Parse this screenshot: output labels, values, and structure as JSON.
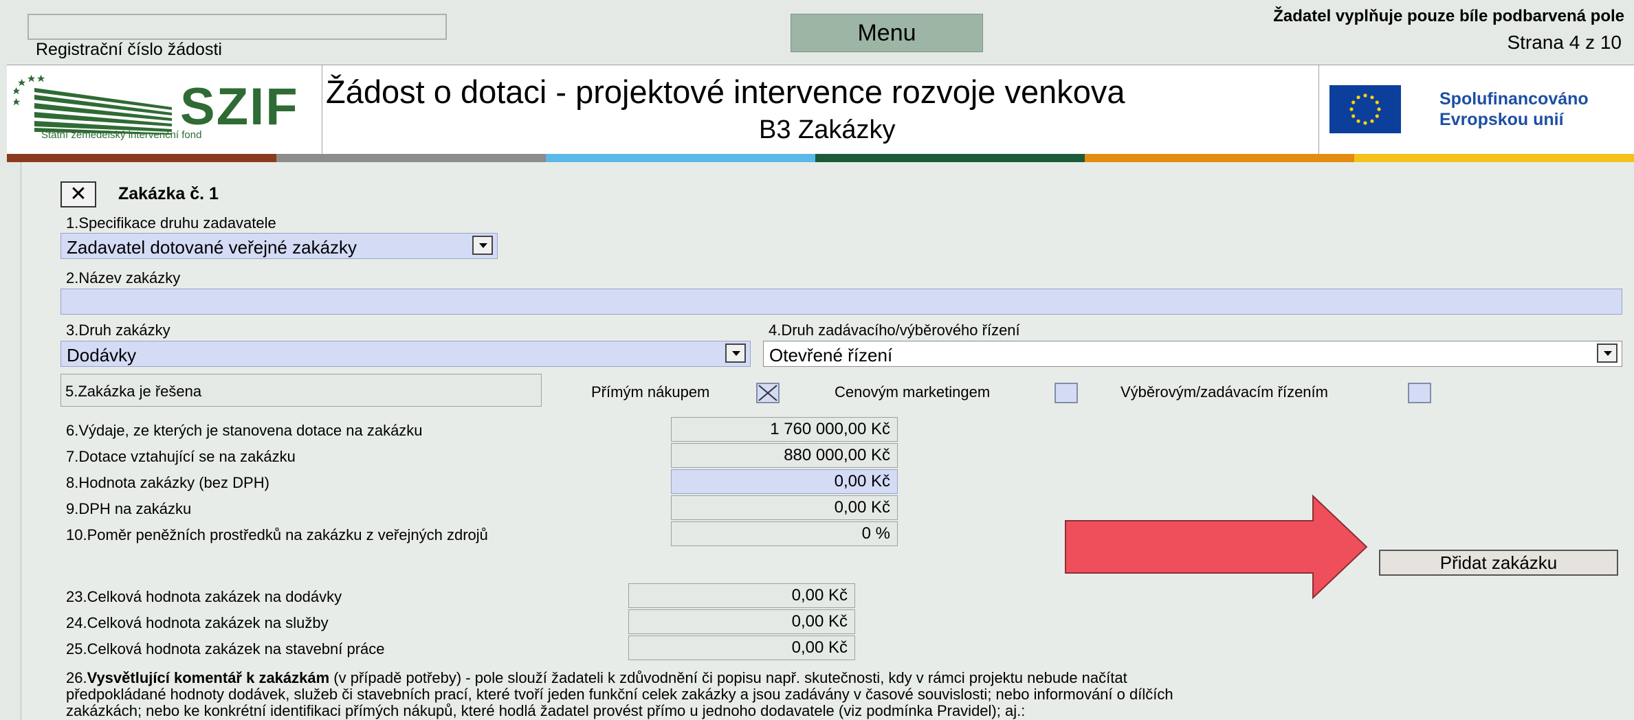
{
  "header": {
    "reg_label": "Registrační číslo žádosti",
    "reg_value": "",
    "menu_label": "Menu",
    "notice": "Žadatel vyplňuje pouze bíle podbarvená pole",
    "page": "Strana 4 z 10"
  },
  "banner": {
    "logo_text": "SZIF",
    "logo_sub": "Státní zemědělský intervenční fond",
    "title": "Žádost o dotaci - projektové intervence rozvoje venkova",
    "subtitle": "B3 Zakázky",
    "eu_line1": "Spolufinancováno",
    "eu_line2": "Evropskou unií"
  },
  "colors": {
    "field_blue": "#d4dbf5",
    "background": "#e4e9e6",
    "arrow": "#ef4f5a",
    "stripes": [
      "#8b3a1e",
      "#8c8c8c",
      "#5ab9e6",
      "#1d5b38",
      "#e48b12",
      "#f4c21a"
    ]
  },
  "form": {
    "zakazka_title": "Zakázka č. 1",
    "remove_icon": "close-icon",
    "f1_label": "1.Specifikace druhu zadavatele",
    "f1_value": "Zadavatel dotované veřejné zakázky",
    "f2_label": "2.Název zakázky",
    "f2_value": "",
    "f3_label": "3.Druh zakázky",
    "f3_value": "Dodávky",
    "f4_label": "4.Druh zadávacího/výběrového řízení",
    "f4_value": "Otevřené řízení",
    "f5_label": "5.Zakázka je řešena",
    "opt_direct": "Přímým nákupem",
    "opt_direct_checked": true,
    "opt_price": "Cenovým marketingem",
    "opt_tender": "Výběrovým/zadávacím řízením",
    "rows": [
      {
        "label": "6.Výdaje, ze kterých je stanovena dotace na zakázku",
        "value": "1 760 000,00 Kč"
      },
      {
        "label": "7.Dotace vztahující se na zakázku",
        "value": "880 000,00 Kč"
      },
      {
        "label": "8.Hodnota zakázky (bez DPH)",
        "value": "0,00 Kč"
      },
      {
        "label": "9.DPH na zakázku",
        "value": "0,00 Kč"
      },
      {
        "label": "10.Poměr peněžních prostředků na zakázku z veřejných zdrojů",
        "value": "0 %"
      }
    ],
    "add_button": "Přidat zakázku"
  },
  "totals": [
    {
      "label": "23.Celková hodnota zakázek na dodávky",
      "value": "0,00 Kč"
    },
    {
      "label": "24.Celková hodnota zakázek na služby",
      "value": "0,00 Kč"
    },
    {
      "label": "25.Celková hodnota zakázek na stavební práce",
      "value": "0,00 Kč"
    }
  ],
  "comment": {
    "number": "26.",
    "title": "Vysvětlující komentář k zakázkám",
    "line1_rest": " (v případě potřeby) - pole slouží žadateli k zdůvodnění či popisu např. skutečnosti, kdy v rámci projektu nebude načítat",
    "line2": "předpokládané hodnoty dodávek, služeb či stavebních prací, které tvoří jeden funkční celek zakázky a jsou zadávány v časové souvislosti; nebo informování o dílčích",
    "line3": "zakázkách; nebo ke konkrétní identifikaci přímých nákupů, které hodlá žadatel provést přímo u jednoho dodavatele (viz podmínka Pravidel); aj.:"
  }
}
